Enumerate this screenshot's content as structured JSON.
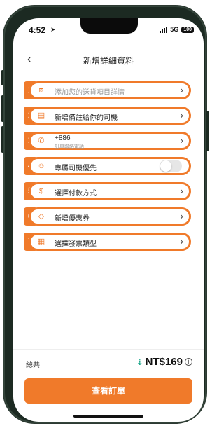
{
  "status_bar": {
    "time": "4:52",
    "location_glyph": "➤",
    "network": "5G",
    "battery": "100"
  },
  "header": {
    "back_glyph": "‹",
    "title": "新增詳細資料"
  },
  "rows": [
    {
      "badge": "1",
      "icon": "box-icon",
      "icon_glyph": "⧈",
      "label": "添加您的送貨項目詳情",
      "placeholder": true
    },
    {
      "badge": "2",
      "icon": "note-icon",
      "icon_glyph": "▤",
      "label": "新增備註給你的司機",
      "placeholder": false
    },
    {
      "badge": "3",
      "icon": "phone-icon",
      "icon_glyph": "✆",
      "label": "+886",
      "hint": "訂單聯絡電話",
      "placeholder": false
    },
    {
      "badge": "4",
      "icon": "driver-icon",
      "icon_glyph": "☺",
      "label": "專屬司機優先",
      "placeholder": false,
      "toggle_on": false
    },
    {
      "badge": "5",
      "icon": "payment-icon",
      "icon_glyph": "$",
      "label": "選擇付款方式",
      "placeholder": false
    },
    {
      "badge": "6",
      "icon": "coupon-icon",
      "icon_glyph": "◇",
      "label": "新增優惠券",
      "placeholder": false
    },
    {
      "badge": "7",
      "icon": "invoice-icon",
      "icon_glyph": "▦",
      "label": "選擇發票類型",
      "placeholder": false
    }
  ],
  "chevron_glyph": "›",
  "footer": {
    "total_label": "總共",
    "price_glyph": "⇣",
    "price": "NT$169",
    "info_glyph": "i",
    "cta_label": "查看訂單"
  },
  "colors": {
    "accent": "#f07a2a",
    "price_icon": "#1aa68a"
  }
}
